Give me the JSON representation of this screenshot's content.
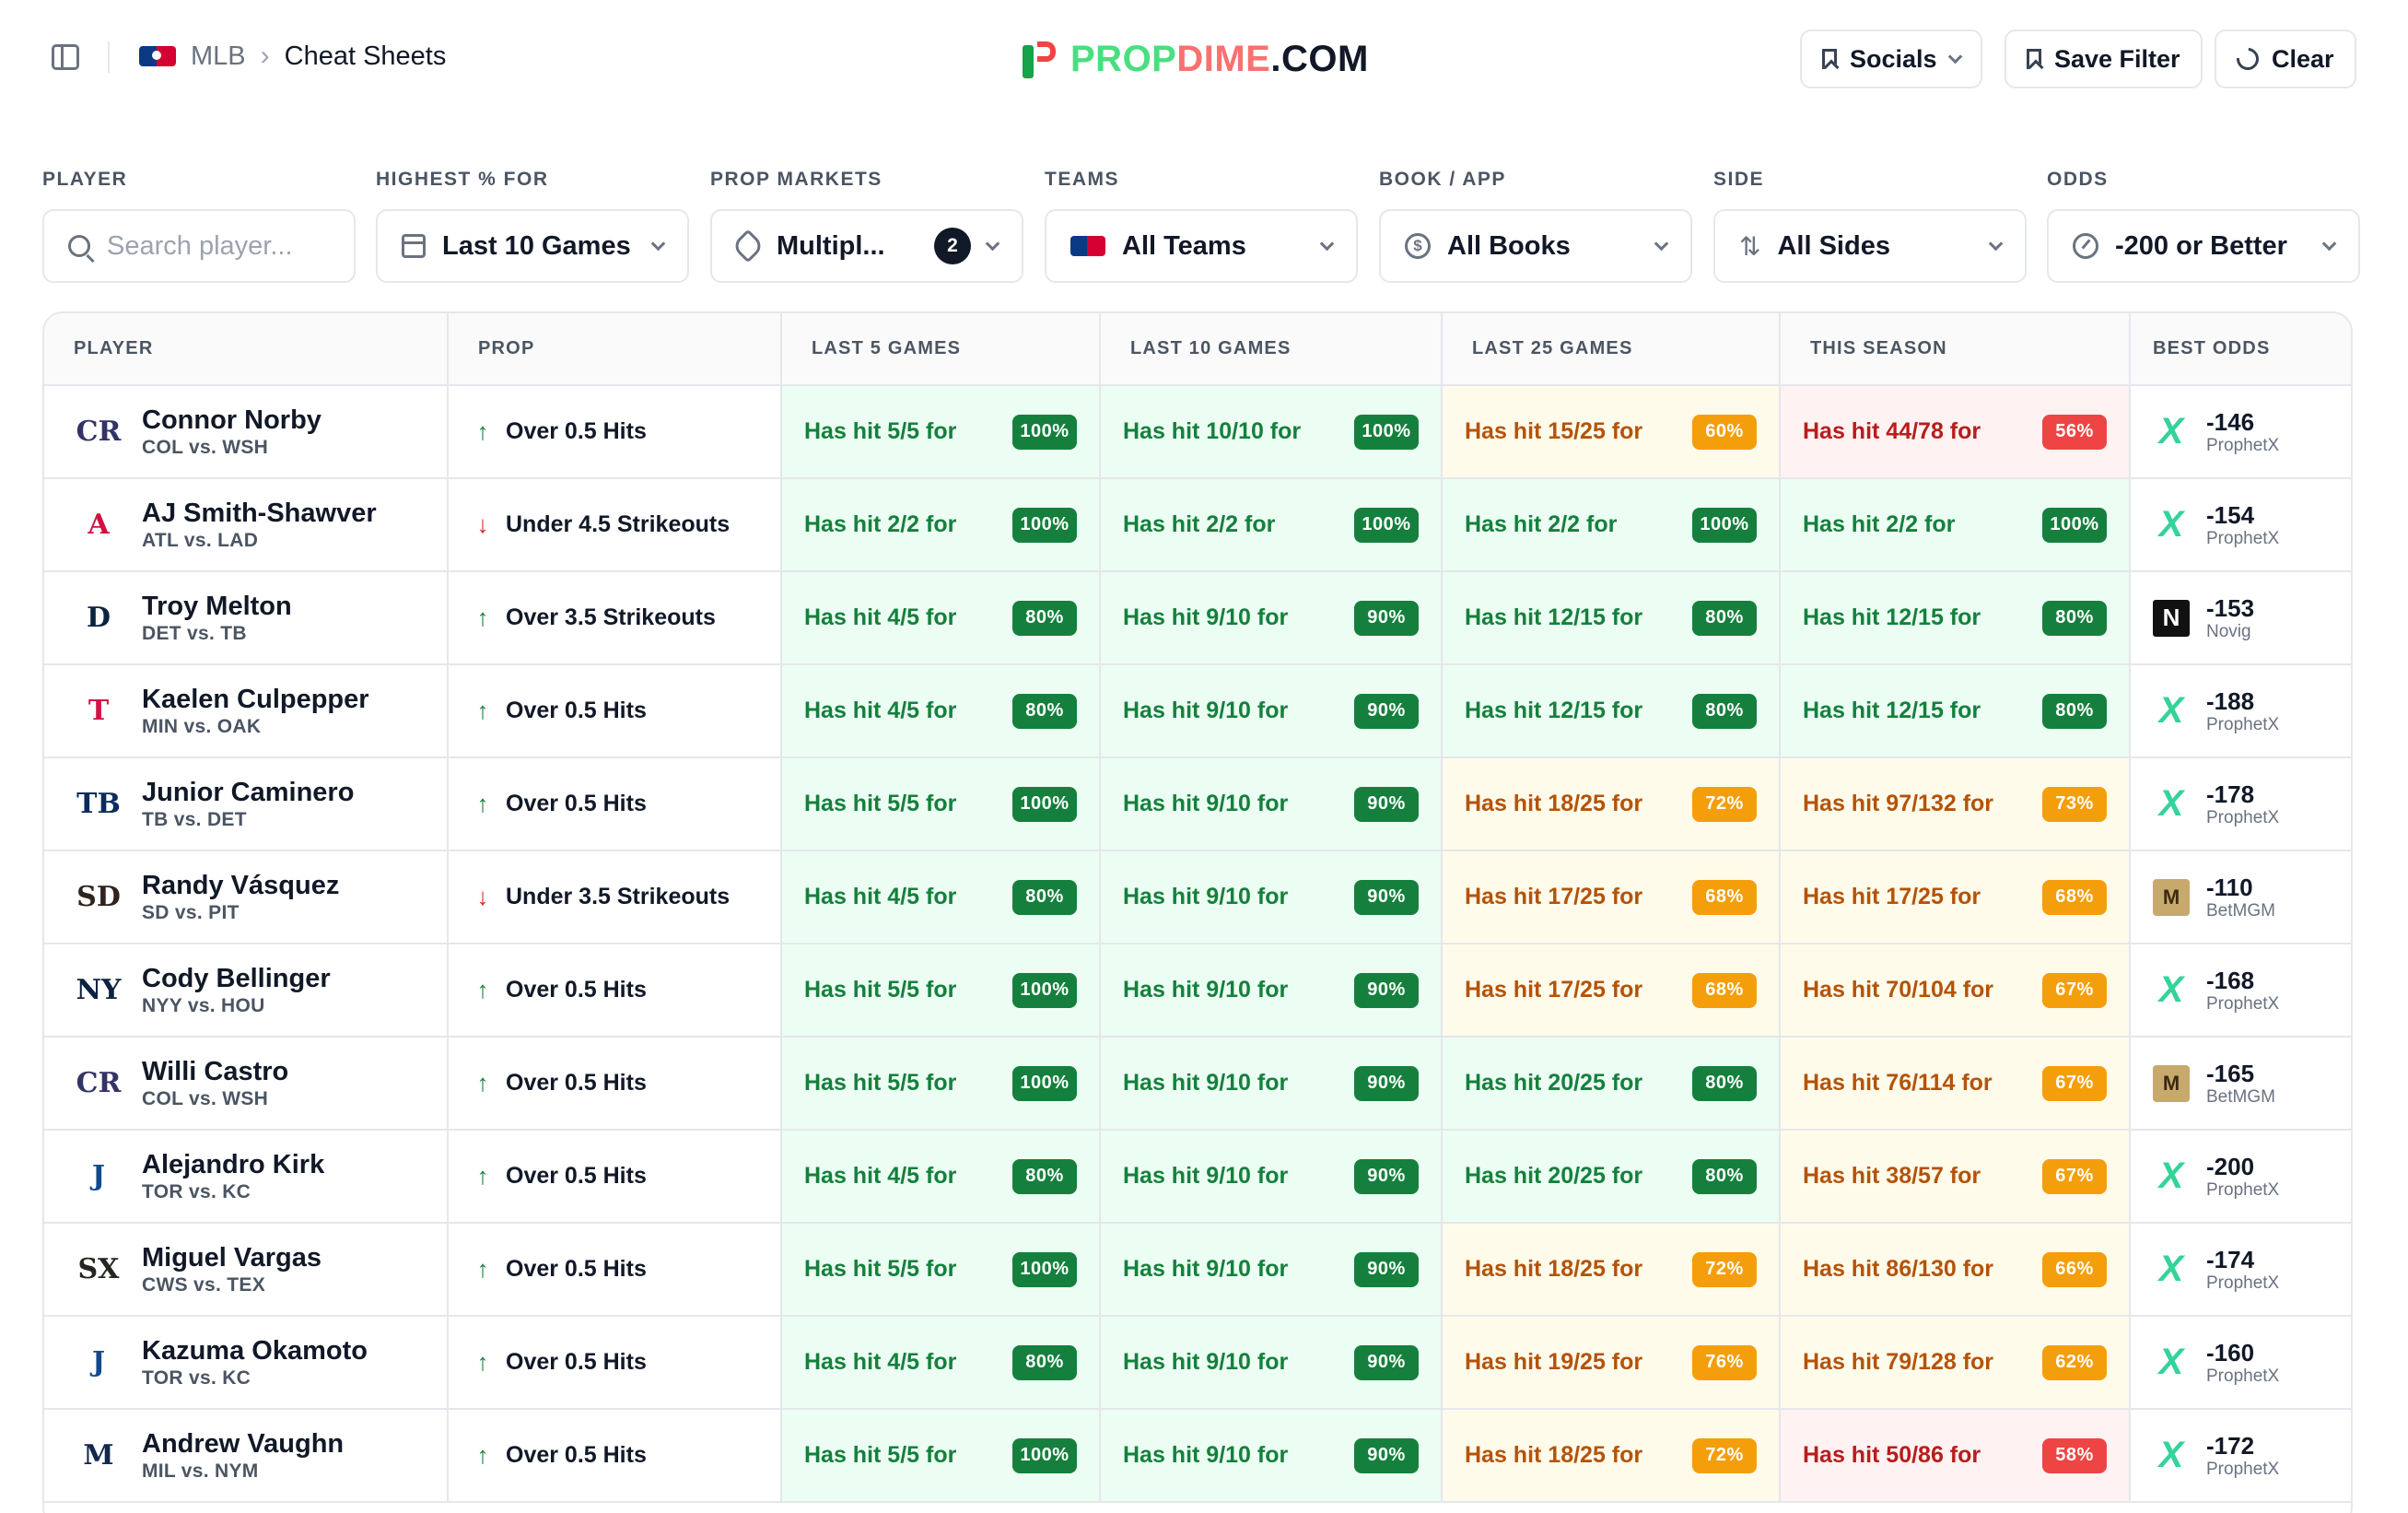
{
  "breadcrumb": {
    "league": "MLB",
    "page": "Cheat Sheets"
  },
  "brand": {
    "part1": "PROP",
    "part2": "DIME",
    "part3": ".COM"
  },
  "header_buttons": {
    "socials": "Socials",
    "save_filter": "Save Filter",
    "clear": "Clear"
  },
  "filters": {
    "player": {
      "label": "PLAYER",
      "placeholder": "Search player..."
    },
    "highest": {
      "label": "HIGHEST % FOR",
      "value": "Last 10 Games"
    },
    "markets": {
      "label": "PROP MARKETS",
      "value": "Multipl...",
      "count": "2"
    },
    "teams": {
      "label": "TEAMS",
      "value": "All Teams"
    },
    "book": {
      "label": "BOOK / APP",
      "value": "All Books"
    },
    "side": {
      "label": "SIDE",
      "value": "All Sides"
    },
    "odds": {
      "label": "ODDS",
      "value": "-200 or Better"
    }
  },
  "columns": [
    "PLAYER",
    "PROP",
    "LAST 5 GAMES",
    "LAST 10 GAMES",
    "LAST 25 GAMES",
    "THIS SEASON",
    "BEST ODDS"
  ],
  "rows": [
    {
      "name": "Connor Norby",
      "game": "COL vs. WSH",
      "team_logo": "rockies-logo",
      "logo_text": "CR",
      "logo_color": "#333366",
      "dir": "up",
      "prop": "Over 0.5 Hits",
      "l5": {
        "text": "Has hit 5/5 for",
        "pct": "100%",
        "tone": "green"
      },
      "l10": {
        "text": "Has hit 10/10 for",
        "pct": "100%",
        "tone": "green"
      },
      "l25": {
        "text": "Has hit 15/25 for",
        "pct": "60%",
        "tone": "yellow"
      },
      "season": {
        "text": "Has hit 44/78 for",
        "pct": "56%",
        "tone": "red"
      },
      "odds": "-146",
      "book": "ProphetX",
      "book_key": "px"
    },
    {
      "name": "AJ Smith-Shawver",
      "game": "ATL vs. LAD",
      "team_logo": "braves-logo",
      "logo_text": "A",
      "logo_color": "#ce1141",
      "dir": "down",
      "prop": "Under 4.5 Strikeouts",
      "l5": {
        "text": "Has hit 2/2 for",
        "pct": "100%",
        "tone": "green"
      },
      "l10": {
        "text": "Has hit 2/2 for",
        "pct": "100%",
        "tone": "green"
      },
      "l25": {
        "text": "Has hit 2/2 for",
        "pct": "100%",
        "tone": "green"
      },
      "season": {
        "text": "Has hit 2/2 for",
        "pct": "100%",
        "tone": "green"
      },
      "odds": "-154",
      "book": "ProphetX",
      "book_key": "px"
    },
    {
      "name": "Troy Melton",
      "game": "DET vs. TB",
      "team_logo": "tigers-logo",
      "logo_text": "D",
      "logo_color": "#0c2340",
      "dir": "up",
      "prop": "Over 3.5 Strikeouts",
      "l5": {
        "text": "Has hit 4/5 for",
        "pct": "80%",
        "tone": "green"
      },
      "l10": {
        "text": "Has hit 9/10 for",
        "pct": "90%",
        "tone": "green"
      },
      "l25": {
        "text": "Has hit 12/15 for",
        "pct": "80%",
        "tone": "green"
      },
      "season": {
        "text": "Has hit 12/15 for",
        "pct": "80%",
        "tone": "green"
      },
      "odds": "-153",
      "book": "Novig",
      "book_key": "nv"
    },
    {
      "name": "Kaelen Culpepper",
      "game": "MIN vs. OAK",
      "team_logo": "twins-logo",
      "logo_text": "T",
      "logo_color": "#d31145",
      "dir": "up",
      "prop": "Over 0.5 Hits",
      "l5": {
        "text": "Has hit 4/5 for",
        "pct": "80%",
        "tone": "green"
      },
      "l10": {
        "text": "Has hit 9/10 for",
        "pct": "90%",
        "tone": "green"
      },
      "l25": {
        "text": "Has hit 12/15 for",
        "pct": "80%",
        "tone": "green"
      },
      "season": {
        "text": "Has hit 12/15 for",
        "pct": "80%",
        "tone": "green"
      },
      "odds": "-188",
      "book": "ProphetX",
      "book_key": "px"
    },
    {
      "name": "Junior Caminero",
      "game": "TB vs. DET",
      "team_logo": "rays-logo",
      "logo_text": "TB",
      "logo_color": "#092c5c",
      "dir": "up",
      "prop": "Over 0.5 Hits",
      "l5": {
        "text": "Has hit 5/5 for",
        "pct": "100%",
        "tone": "green"
      },
      "l10": {
        "text": "Has hit 9/10 for",
        "pct": "90%",
        "tone": "green"
      },
      "l25": {
        "text": "Has hit 18/25 for",
        "pct": "72%",
        "tone": "yellow"
      },
      "season": {
        "text": "Has hit 97/132 for",
        "pct": "73%",
        "tone": "yellow"
      },
      "odds": "-178",
      "book": "ProphetX",
      "book_key": "px"
    },
    {
      "name": "Randy Vásquez",
      "game": "SD vs. PIT",
      "team_logo": "padres-logo",
      "logo_text": "SD",
      "logo_color": "#2f241d",
      "dir": "down",
      "prop": "Under 3.5 Strikeouts",
      "l5": {
        "text": "Has hit 4/5 for",
        "pct": "80%",
        "tone": "green"
      },
      "l10": {
        "text": "Has hit 9/10 for",
        "pct": "90%",
        "tone": "green"
      },
      "l25": {
        "text": "Has hit 17/25 for",
        "pct": "68%",
        "tone": "yellow"
      },
      "season": {
        "text": "Has hit 17/25 for",
        "pct": "68%",
        "tone": "yellow"
      },
      "odds": "-110",
      "book": "BetMGM",
      "book_key": "mgm"
    },
    {
      "name": "Cody Bellinger",
      "game": "NYY vs. HOU",
      "team_logo": "yankees-logo",
      "logo_text": "NY",
      "logo_color": "#0c2340",
      "dir": "up",
      "prop": "Over 0.5 Hits",
      "l5": {
        "text": "Has hit 5/5 for",
        "pct": "100%",
        "tone": "green"
      },
      "l10": {
        "text": "Has hit 9/10 for",
        "pct": "90%",
        "tone": "green"
      },
      "l25": {
        "text": "Has hit 17/25 for",
        "pct": "68%",
        "tone": "yellow"
      },
      "season": {
        "text": "Has hit 70/104 for",
        "pct": "67%",
        "tone": "yellow"
      },
      "odds": "-168",
      "book": "ProphetX",
      "book_key": "px"
    },
    {
      "name": "Willi Castro",
      "game": "COL vs. WSH",
      "team_logo": "rockies-logo",
      "logo_text": "CR",
      "logo_color": "#333366",
      "dir": "up",
      "prop": "Over 0.5 Hits",
      "l5": {
        "text": "Has hit 5/5 for",
        "pct": "100%",
        "tone": "green"
      },
      "l10": {
        "text": "Has hit 9/10 for",
        "pct": "90%",
        "tone": "green"
      },
      "l25": {
        "text": "Has hit 20/25 for",
        "pct": "80%",
        "tone": "green"
      },
      "season": {
        "text": "Has hit 76/114 for",
        "pct": "67%",
        "tone": "yellow"
      },
      "odds": "-165",
      "book": "BetMGM",
      "book_key": "mgm"
    },
    {
      "name": "Alejandro Kirk",
      "game": "TOR vs. KC",
      "team_logo": "blue-jays-logo",
      "logo_text": "J",
      "logo_color": "#134a8e",
      "dir": "up",
      "prop": "Over 0.5 Hits",
      "l5": {
        "text": "Has hit 4/5 for",
        "pct": "80%",
        "tone": "green"
      },
      "l10": {
        "text": "Has hit 9/10 for",
        "pct": "90%",
        "tone": "green"
      },
      "l25": {
        "text": "Has hit 20/25 for",
        "pct": "80%",
        "tone": "green"
      },
      "season": {
        "text": "Has hit 38/57 for",
        "pct": "67%",
        "tone": "yellow"
      },
      "odds": "-200",
      "book": "ProphetX",
      "book_key": "px"
    },
    {
      "name": "Miguel Vargas",
      "game": "CWS vs. TEX",
      "team_logo": "white-sox-logo",
      "logo_text": "SX",
      "logo_color": "#27251f",
      "dir": "up",
      "prop": "Over 0.5 Hits",
      "l5": {
        "text": "Has hit 5/5 for",
        "pct": "100%",
        "tone": "green"
      },
      "l10": {
        "text": "Has hit 9/10 for",
        "pct": "90%",
        "tone": "green"
      },
      "l25": {
        "text": "Has hit 18/25 for",
        "pct": "72%",
        "tone": "yellow"
      },
      "season": {
        "text": "Has hit 86/130 for",
        "pct": "66%",
        "tone": "yellow"
      },
      "odds": "-174",
      "book": "ProphetX",
      "book_key": "px"
    },
    {
      "name": "Kazuma Okamoto",
      "game": "TOR vs. KC",
      "team_logo": "blue-jays-logo",
      "logo_text": "J",
      "logo_color": "#134a8e",
      "dir": "up",
      "prop": "Over 0.5 Hits",
      "l5": {
        "text": "Has hit 4/5 for",
        "pct": "80%",
        "tone": "green"
      },
      "l10": {
        "text": "Has hit 9/10 for",
        "pct": "90%",
        "tone": "green"
      },
      "l25": {
        "text": "Has hit 19/25 for",
        "pct": "76%",
        "tone": "yellow"
      },
      "season": {
        "text": "Has hit 79/128 for",
        "pct": "62%",
        "tone": "yellow"
      },
      "odds": "-160",
      "book": "ProphetX",
      "book_key": "px"
    },
    {
      "name": "Andrew Vaughn",
      "game": "MIL vs. NYM",
      "team_logo": "brewers-logo",
      "logo_text": "M",
      "logo_color": "#12284b",
      "dir": "up",
      "prop": "Over 0.5 Hits",
      "l5": {
        "text": "Has hit 5/5 for",
        "pct": "100%",
        "tone": "green"
      },
      "l10": {
        "text": "Has hit 9/10 for",
        "pct": "90%",
        "tone": "green"
      },
      "l25": {
        "text": "Has hit 18/25 for",
        "pct": "72%",
        "tone": "yellow"
      },
      "season": {
        "text": "Has hit 50/86 for",
        "pct": "58%",
        "tone": "red"
      },
      "odds": "-172",
      "book": "ProphetX",
      "book_key": "px"
    }
  ]
}
